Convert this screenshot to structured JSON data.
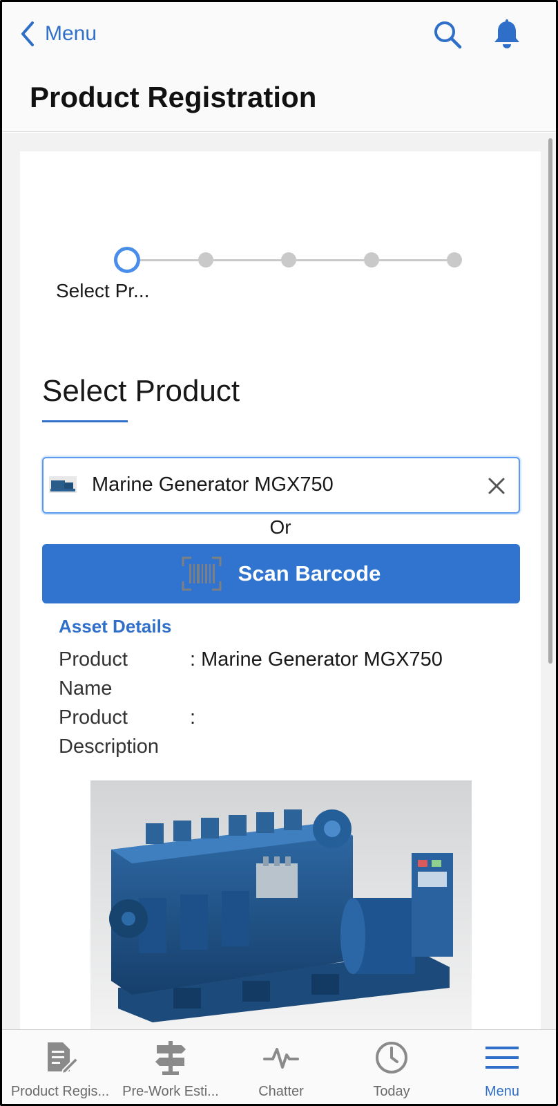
{
  "header": {
    "back_label": "Menu",
    "title": "Product Registration"
  },
  "stepper": {
    "current_step_label": "Select Pr...",
    "total_steps": 5,
    "current_step": 1
  },
  "section": {
    "title": "Select Product"
  },
  "lookup": {
    "value": "Marine Generator MGX750"
  },
  "or_text": "Or",
  "scan_button": {
    "label": "Scan Barcode"
  },
  "asset_details": {
    "heading": "Asset Details",
    "fields": [
      {
        "label": "Product Name",
        "value": ": Marine Generator MGX750"
      },
      {
        "label": "Product Description",
        "value": ":"
      }
    ]
  },
  "tabs": [
    {
      "label": "Product Regis...",
      "icon": "document-edit-icon"
    },
    {
      "label": "Pre-Work Esti...",
      "icon": "signpost-icon"
    },
    {
      "label": "Chatter",
      "icon": "pulse-icon"
    },
    {
      "label": "Today",
      "icon": "clock-icon"
    },
    {
      "label": "Menu",
      "icon": "hamburger-menu-icon",
      "active": true
    }
  ],
  "colors": {
    "accent": "#2f6fc9",
    "button": "#3074cf",
    "stepper_active": "#4a8ee9",
    "stepper_inactive": "#c9c9c9"
  }
}
